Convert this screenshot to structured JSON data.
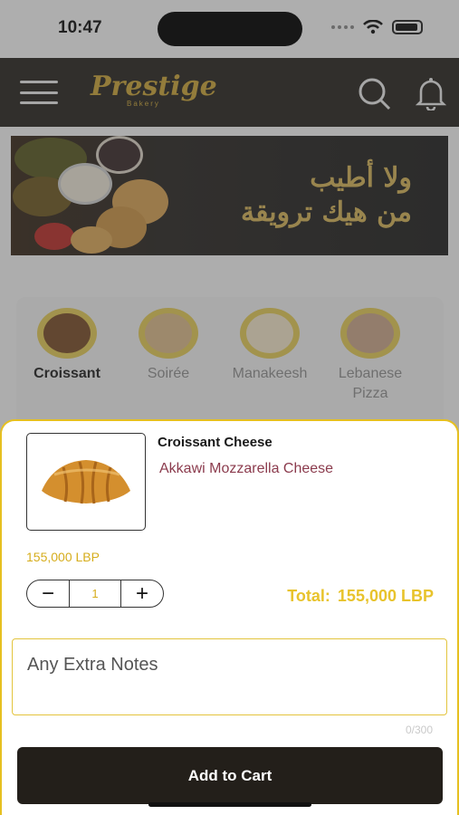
{
  "status_bar": {
    "time": "10:47"
  },
  "header": {
    "logo_text": "Prestige",
    "logo_subtext": "Bakery"
  },
  "banner": {
    "arabic_line1": "ولا أطيب",
    "arabic_line2": "من هيك ترويقة"
  },
  "categories": [
    {
      "label": "Croissant",
      "active": true
    },
    {
      "label": "Soirée",
      "active": false
    },
    {
      "label": "Manakeesh",
      "active": false
    },
    {
      "label": "Lebanese Pizza",
      "active": false
    }
  ],
  "product": {
    "name": "Croissant Cheese",
    "description": "Akkawi Mozzarella Cheese",
    "unit_price": "155,000 LBP",
    "quantity": "1",
    "minus": "−",
    "plus": "+",
    "total_label": "Total:",
    "total_value": "155,000 LBP"
  },
  "notes": {
    "placeholder": "Any Extra Notes",
    "counter": "0/300"
  },
  "actions": {
    "add_to_cart": "Add to Cart"
  },
  "colors": {
    "accent": "#e6c020",
    "dark": "#231f1a",
    "description": "#8b3b4d"
  }
}
